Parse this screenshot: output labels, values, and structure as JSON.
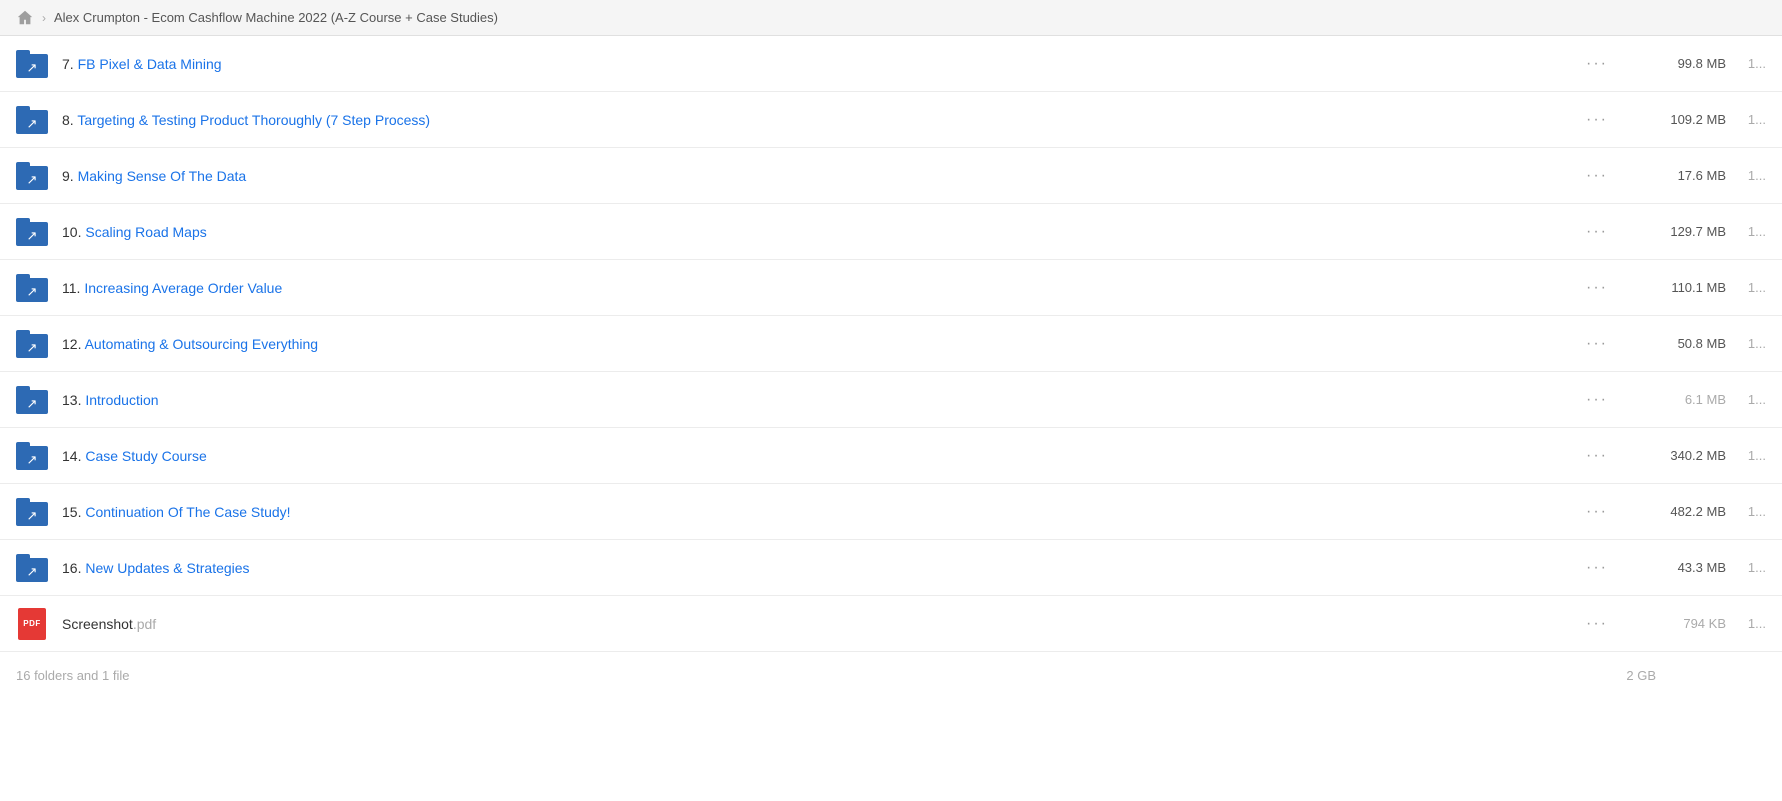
{
  "titleBar": {
    "homeIcon": "home",
    "chevron": "›",
    "title": "Alex Crumpton - Ecom Cashflow Machine 2022 (A-Z Course + Case Studies)"
  },
  "files": [
    {
      "id": "row-7",
      "type": "folder",
      "name": "7. FB Pixel & Data Mining",
      "nameParts": [
        {
          "text": "7. ",
          "style": "normal"
        },
        {
          "text": "FB Pixel & Data Mining",
          "style": "highlight"
        }
      ],
      "size": "99.8 MB",
      "sizeMuted": false,
      "date": "1..."
    },
    {
      "id": "row-8",
      "type": "folder",
      "name": "8. Targeting & Testing Product Thoroughly (7 Step Process)",
      "nameParts": [
        {
          "text": "8. ",
          "style": "normal"
        },
        {
          "text": "Targeting & Testing Product Thoroughly (7 Step Process)",
          "style": "highlight"
        }
      ],
      "size": "109.2 MB",
      "sizeMuted": false,
      "date": "1..."
    },
    {
      "id": "row-9",
      "type": "folder",
      "name": "9. Making Sense Of The Data",
      "nameParts": [
        {
          "text": "9. ",
          "style": "normal"
        },
        {
          "text": "Making Sense Of The Data",
          "style": "highlight"
        }
      ],
      "size": "17.6 MB",
      "sizeMuted": false,
      "date": "1..."
    },
    {
      "id": "row-10",
      "type": "folder",
      "name": "10. Scaling Road Maps",
      "nameParts": [
        {
          "text": "10. ",
          "style": "normal"
        },
        {
          "text": "Scaling Road Maps",
          "style": "highlight"
        }
      ],
      "size": "129.7 MB",
      "sizeMuted": false,
      "date": "1..."
    },
    {
      "id": "row-11",
      "type": "folder",
      "name": "11. Increasing Average Order Value",
      "nameParts": [
        {
          "text": "11. ",
          "style": "normal"
        },
        {
          "text": "Increasing Average Order Value",
          "style": "highlight"
        }
      ],
      "size": "110.1 MB",
      "sizeMuted": false,
      "date": "1..."
    },
    {
      "id": "row-12",
      "type": "folder",
      "name": "12. Automating & Outsourcing Everything",
      "nameParts": [
        {
          "text": "12. ",
          "style": "normal"
        },
        {
          "text": "Automating & Outsourcing Everything",
          "style": "highlight"
        }
      ],
      "size": "50.8 MB",
      "sizeMuted": false,
      "date": "1..."
    },
    {
      "id": "row-13",
      "type": "folder",
      "name": "13. Introduction",
      "nameParts": [
        {
          "text": "13. ",
          "style": "normal"
        },
        {
          "text": "Introduction",
          "style": "highlight"
        }
      ],
      "size": "6.1 MB",
      "sizeMuted": true,
      "date": "1..."
    },
    {
      "id": "row-14",
      "type": "folder",
      "name": "14. Case Study Course",
      "nameParts": [
        {
          "text": "14. ",
          "style": "normal"
        },
        {
          "text": "Case Study Course",
          "style": "highlight"
        }
      ],
      "size": "340.2 MB",
      "sizeMuted": false,
      "date": "1..."
    },
    {
      "id": "row-15",
      "type": "folder",
      "name": "15. Continuation Of The Case Study!",
      "nameParts": [
        {
          "text": "15. ",
          "style": "normal"
        },
        {
          "text": "Continuation Of The Case Study!",
          "style": "highlight"
        }
      ],
      "size": "482.2 MB",
      "sizeMuted": false,
      "date": "1..."
    },
    {
      "id": "row-16",
      "type": "folder",
      "name": "16. New Updates & Strategies",
      "nameParts": [
        {
          "text": "16. ",
          "style": "normal"
        },
        {
          "text": "New Updates & Strategies",
          "style": "highlight"
        }
      ],
      "size": "43.3 MB",
      "sizeMuted": false,
      "date": "1..."
    },
    {
      "id": "row-screenshot",
      "type": "pdf",
      "name": "Screenshot.pdf",
      "nameParts": [
        {
          "text": "Screenshot",
          "style": "normal"
        },
        {
          "text": ".pdf",
          "style": "muted"
        }
      ],
      "size": "794 KB",
      "sizeMuted": true,
      "date": "1..."
    }
  ],
  "footer": {
    "label": "16 folders and 1 file",
    "totalSize": "2 GB"
  },
  "icons": {
    "more": "···",
    "folderArrow": "↗",
    "pdfLabel": "PDF"
  }
}
